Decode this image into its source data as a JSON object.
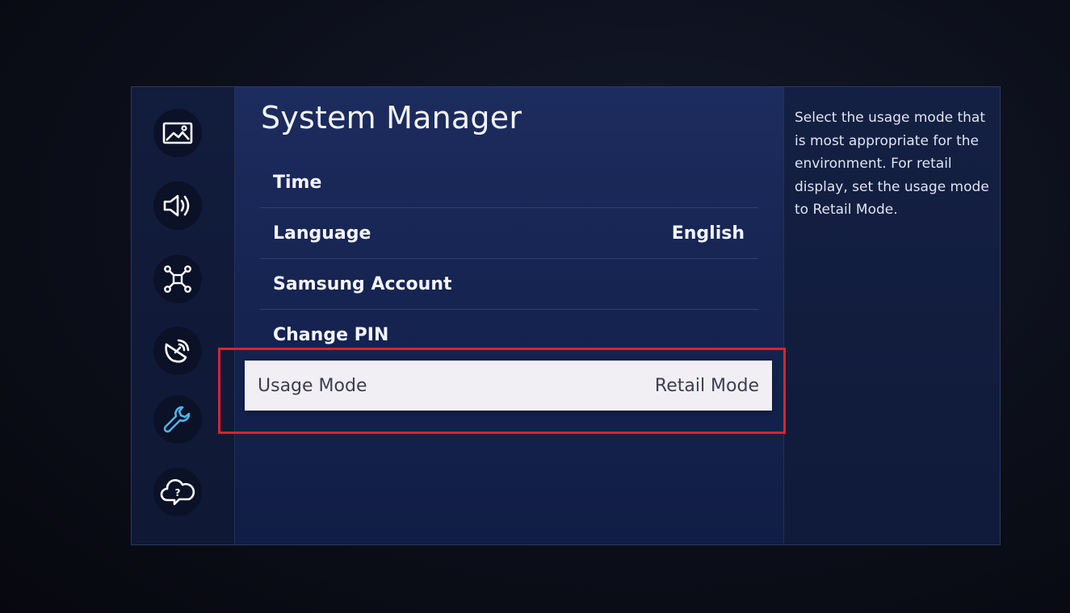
{
  "sidebar": {
    "items": [
      {
        "icon": "picture-icon",
        "active": false
      },
      {
        "icon": "sound-icon",
        "active": false
      },
      {
        "icon": "network-icon",
        "active": false
      },
      {
        "icon": "broadcasting-icon",
        "active": false
      },
      {
        "icon": "wrench-icon",
        "active": true
      },
      {
        "icon": "support-cloud-icon",
        "active": false
      }
    ]
  },
  "main": {
    "title": "System Manager",
    "items": [
      {
        "label": "Time",
        "value": ""
      },
      {
        "label": "Language",
        "value": "English"
      },
      {
        "label": "Samsung Account",
        "value": ""
      },
      {
        "label": "Change PIN",
        "value": ""
      },
      {
        "label": "Usage Mode",
        "value": "Retail Mode",
        "selected": true
      }
    ]
  },
  "help": {
    "text": "Select the usage mode that is most appropriate for the environment. For retail display, set the usage mode to Retail Mode."
  },
  "colors": {
    "highlight_border": "#d7232f",
    "active_icon": "#4fb3e8",
    "selected_row_bg": "#f1eff4"
  }
}
